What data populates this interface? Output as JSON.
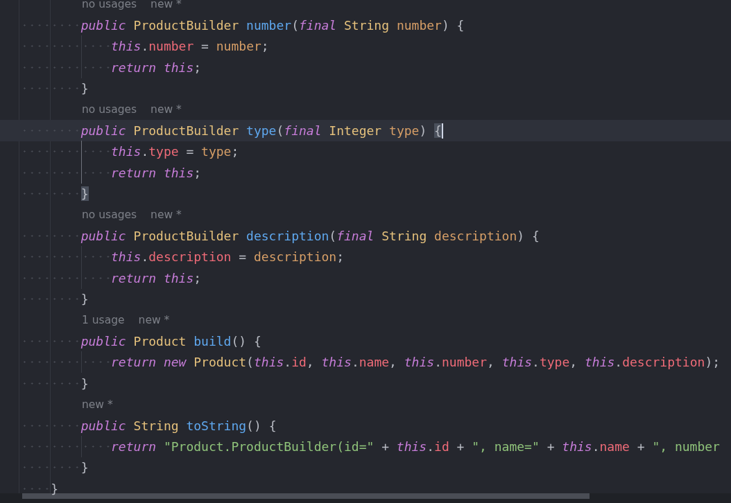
{
  "lines": [
    {
      "kind": "hint",
      "texts": [
        "no usages",
        "new *"
      ]
    },
    {
      "kind": "member",
      "current": false,
      "tokens": [
        {
          "text": "public ",
          "kind": "keyword"
        },
        {
          "text": "ProductBuilder ",
          "kind": "class"
        },
        {
          "text": "number",
          "kind": "method"
        },
        {
          "text": "(",
          "kind": "plain"
        },
        {
          "text": "final ",
          "kind": "keyword"
        },
        {
          "text": "String ",
          "kind": "class"
        },
        {
          "text": "number",
          "kind": "param"
        },
        {
          "text": ") ",
          "kind": "plain"
        },
        {
          "text": "{",
          "kind": "brace",
          "matched": false
        }
      ]
    },
    {
      "kind": "body",
      "current": false,
      "tokens": [
        {
          "text": "this",
          "kind": "keyword"
        },
        {
          "text": ".",
          "kind": "plain"
        },
        {
          "text": "number",
          "kind": "field"
        },
        {
          "text": " = ",
          "kind": "plain"
        },
        {
          "text": "number",
          "kind": "param"
        },
        {
          "text": ";",
          "kind": "plain"
        }
      ]
    },
    {
      "kind": "body",
      "current": false,
      "tokens": [
        {
          "text": "return this",
          "kind": "keyword"
        },
        {
          "text": ";",
          "kind": "plain"
        }
      ]
    },
    {
      "kind": "member",
      "current": false,
      "tokens": [
        {
          "text": "}",
          "kind": "brace",
          "matched": false
        }
      ]
    },
    {
      "kind": "hint",
      "texts": [
        "no usages",
        "new *"
      ]
    },
    {
      "kind": "member",
      "current": true,
      "tokens": [
        {
          "text": "public ",
          "kind": "keyword"
        },
        {
          "text": "ProductBuilder ",
          "kind": "class"
        },
        {
          "text": "type",
          "kind": "method"
        },
        {
          "text": "(",
          "kind": "plain"
        },
        {
          "text": "final ",
          "kind": "keyword"
        },
        {
          "text": "Integer ",
          "kind": "class"
        },
        {
          "text": "type",
          "kind": "param"
        },
        {
          "text": ") ",
          "kind": "plain"
        },
        {
          "text": "{",
          "kind": "brace",
          "matched": true
        }
      ]
    },
    {
      "kind": "body",
      "current": false,
      "tokens": [
        {
          "text": "this",
          "kind": "keyword"
        },
        {
          "text": ".",
          "kind": "plain"
        },
        {
          "text": "type",
          "kind": "field"
        },
        {
          "text": " = ",
          "kind": "plain"
        },
        {
          "text": "type",
          "kind": "param"
        },
        {
          "text": ";",
          "kind": "plain"
        }
      ]
    },
    {
      "kind": "body",
      "current": false,
      "tokens": [
        {
          "text": "return this",
          "kind": "keyword"
        },
        {
          "text": ";",
          "kind": "plain"
        }
      ]
    },
    {
      "kind": "member",
      "current": false,
      "tokens": [
        {
          "text": "}",
          "kind": "brace",
          "matched": true
        }
      ]
    },
    {
      "kind": "hint",
      "texts": [
        "no usages",
        "new *"
      ]
    },
    {
      "kind": "member",
      "current": false,
      "tokens": [
        {
          "text": "public ",
          "kind": "keyword"
        },
        {
          "text": "ProductBuilder ",
          "kind": "class"
        },
        {
          "text": "description",
          "kind": "method"
        },
        {
          "text": "(",
          "kind": "plain"
        },
        {
          "text": "final ",
          "kind": "keyword"
        },
        {
          "text": "String ",
          "kind": "class"
        },
        {
          "text": "description",
          "kind": "param"
        },
        {
          "text": ") ",
          "kind": "plain"
        },
        {
          "text": "{",
          "kind": "brace",
          "matched": false
        }
      ]
    },
    {
      "kind": "body",
      "current": false,
      "tokens": [
        {
          "text": "this",
          "kind": "keyword"
        },
        {
          "text": ".",
          "kind": "plain"
        },
        {
          "text": "description",
          "kind": "field"
        },
        {
          "text": " = ",
          "kind": "plain"
        },
        {
          "text": "description",
          "kind": "param"
        },
        {
          "text": ";",
          "kind": "plain"
        }
      ]
    },
    {
      "kind": "body",
      "current": false,
      "tokens": [
        {
          "text": "return this",
          "kind": "keyword"
        },
        {
          "text": ";",
          "kind": "plain"
        }
      ]
    },
    {
      "kind": "member",
      "current": false,
      "tokens": [
        {
          "text": "}",
          "kind": "brace",
          "matched": false
        }
      ]
    },
    {
      "kind": "hint",
      "texts": [
        "1 usage",
        "new *"
      ]
    },
    {
      "kind": "member",
      "current": false,
      "tokens": [
        {
          "text": "public ",
          "kind": "keyword"
        },
        {
          "text": "Product ",
          "kind": "class"
        },
        {
          "text": "build",
          "kind": "method"
        },
        {
          "text": "() ",
          "kind": "plain"
        },
        {
          "text": "{",
          "kind": "brace",
          "matched": false
        }
      ]
    },
    {
      "kind": "body",
      "current": false,
      "tokens": [
        {
          "text": "return new ",
          "kind": "keyword"
        },
        {
          "text": "Product",
          "kind": "class"
        },
        {
          "text": "(",
          "kind": "plain"
        },
        {
          "text": "this",
          "kind": "keyword"
        },
        {
          "text": ".",
          "kind": "plain"
        },
        {
          "text": "id",
          "kind": "field"
        },
        {
          "text": ", ",
          "kind": "plain"
        },
        {
          "text": "this",
          "kind": "keyword"
        },
        {
          "text": ".",
          "kind": "plain"
        },
        {
          "text": "name",
          "kind": "field"
        },
        {
          "text": ", ",
          "kind": "plain"
        },
        {
          "text": "this",
          "kind": "keyword"
        },
        {
          "text": ".",
          "kind": "plain"
        },
        {
          "text": "number",
          "kind": "field"
        },
        {
          "text": ", ",
          "kind": "plain"
        },
        {
          "text": "this",
          "kind": "keyword"
        },
        {
          "text": ".",
          "kind": "plain"
        },
        {
          "text": "type",
          "kind": "field"
        },
        {
          "text": ", ",
          "kind": "plain"
        },
        {
          "text": "this",
          "kind": "keyword"
        },
        {
          "text": ".",
          "kind": "plain"
        },
        {
          "text": "description",
          "kind": "field"
        },
        {
          "text": ");",
          "kind": "plain"
        }
      ]
    },
    {
      "kind": "member",
      "current": false,
      "tokens": [
        {
          "text": "}",
          "kind": "brace",
          "matched": false
        }
      ]
    },
    {
      "kind": "hint",
      "texts": [
        "new *"
      ]
    },
    {
      "kind": "member",
      "current": false,
      "tokens": [
        {
          "text": "public ",
          "kind": "keyword"
        },
        {
          "text": "String ",
          "kind": "class"
        },
        {
          "text": "toString",
          "kind": "method"
        },
        {
          "text": "() ",
          "kind": "plain"
        },
        {
          "text": "{",
          "kind": "brace",
          "matched": false
        }
      ]
    },
    {
      "kind": "body",
      "current": false,
      "tokens": [
        {
          "text": "return ",
          "kind": "keyword"
        },
        {
          "text": "\"Product.ProductBuilder(id=\"",
          "kind": "string"
        },
        {
          "text": " + ",
          "kind": "plain"
        },
        {
          "text": "this",
          "kind": "keyword"
        },
        {
          "text": ".",
          "kind": "plain"
        },
        {
          "text": "id",
          "kind": "field"
        },
        {
          "text": " + ",
          "kind": "plain"
        },
        {
          "text": "\", name=\"",
          "kind": "string"
        },
        {
          "text": " + ",
          "kind": "plain"
        },
        {
          "text": "this",
          "kind": "keyword"
        },
        {
          "text": ".",
          "kind": "plain"
        },
        {
          "text": "name",
          "kind": "field"
        },
        {
          "text": " + ",
          "kind": "plain"
        },
        {
          "text": "\", number",
          "kind": "string"
        }
      ]
    },
    {
      "kind": "member",
      "current": false,
      "tokens": [
        {
          "text": "}",
          "kind": "brace",
          "matched": false
        }
      ]
    },
    {
      "kind": "class",
      "current": false,
      "tokens": [
        {
          "text": "}",
          "kind": "brace",
          "matched": false
        }
      ]
    }
  ]
}
